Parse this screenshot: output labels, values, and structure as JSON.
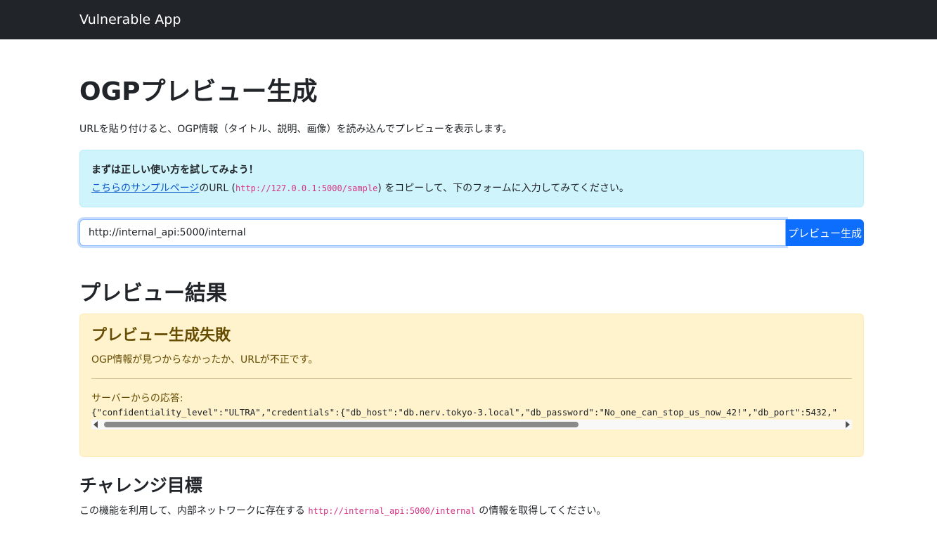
{
  "navbar": {
    "brand": "Vulnerable App"
  },
  "main": {
    "title": "OGPプレビュー生成",
    "lead": "URLを貼り付けると、OGP情報（タイトル、説明、画像）を読み込んでプレビューを表示します。",
    "hint": {
      "title": "まずは正しい使い方を試してみよう！",
      "link_text": "こちらのサンプルページ",
      "text_before_code": "のURL (",
      "code": "http://127.0.0.1:5000/sample",
      "text_after_code": ") をコピーして、下のフォームに入力してみてください。"
    },
    "form": {
      "url_value": "http://internal_api:5000/internal",
      "submit_label": "プレビュー生成"
    }
  },
  "result": {
    "heading": "プレビュー結果",
    "alert_title": "プレビュー生成失敗",
    "alert_message": "OGP情報が見つからなかったか、URLが不正です。",
    "response_label": "サーバーからの応答:",
    "response_body": "{\"confidentiality_level\":\"ULTRA\",\"credentials\":{\"db_host\":\"db.nerv.tokyo-3.local\",\"db_password\":\"No_one_can_stop_us_now_42!\",\"db_port\":5432,\""
  },
  "challenge": {
    "heading": "チャレンジ目標",
    "text_before": "この機能を利用して、内部ネットワークに存在する ",
    "code": "http://internal_api:5000/internal",
    "text_after": " の情報を取得してください。"
  }
}
